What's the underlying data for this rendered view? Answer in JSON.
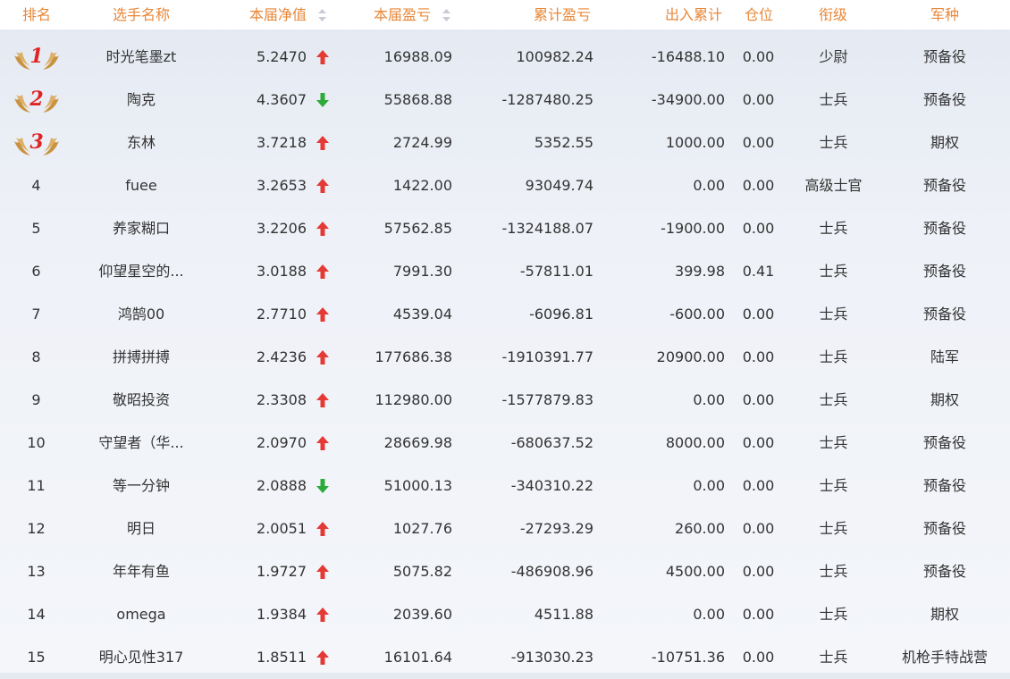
{
  "headers": {
    "rank": "排名",
    "name": "选手名称",
    "nav": "本届净值",
    "pnl": "本届盈亏",
    "total_pnl": "累计盈亏",
    "flow": "出入累计",
    "position": "仓位",
    "title": "衔级",
    "corps": "军种"
  },
  "rows": [
    {
      "rank": "1",
      "name": "时光笔墨zt",
      "nav": "5.2470",
      "trend": "up",
      "pnl": "16988.09",
      "total_pnl": "100982.24",
      "flow": "-16488.10",
      "position": "0.00",
      "title": "少尉",
      "corps": "预备役"
    },
    {
      "rank": "2",
      "name": "陶克",
      "nav": "4.3607",
      "trend": "down",
      "pnl": "55868.88",
      "total_pnl": "-1287480.25",
      "flow": "-34900.00",
      "position": "0.00",
      "title": "士兵",
      "corps": "预备役"
    },
    {
      "rank": "3",
      "name": "东林",
      "nav": "3.7218",
      "trend": "up",
      "pnl": "2724.99",
      "total_pnl": "5352.55",
      "flow": "1000.00",
      "position": "0.00",
      "title": "士兵",
      "corps": "期权"
    },
    {
      "rank": "4",
      "name": "fuee",
      "nav": "3.2653",
      "trend": "up",
      "pnl": "1422.00",
      "total_pnl": "93049.74",
      "flow": "0.00",
      "position": "0.00",
      "title": "高级士官",
      "corps": "预备役"
    },
    {
      "rank": "5",
      "name": "养家糊口",
      "nav": "3.2206",
      "trend": "up",
      "pnl": "57562.85",
      "total_pnl": "-1324188.07",
      "flow": "-1900.00",
      "position": "0.00",
      "title": "士兵",
      "corps": "预备役"
    },
    {
      "rank": "6",
      "name": "仰望星空的...",
      "nav": "3.0188",
      "trend": "up",
      "pnl": "7991.30",
      "total_pnl": "-57811.01",
      "flow": "399.98",
      "position": "0.41",
      "title": "士兵",
      "corps": "预备役"
    },
    {
      "rank": "7",
      "name": "鸿鹄00",
      "nav": "2.7710",
      "trend": "up",
      "pnl": "4539.04",
      "total_pnl": "-6096.81",
      "flow": "-600.00",
      "position": "0.00",
      "title": "士兵",
      "corps": "预备役"
    },
    {
      "rank": "8",
      "name": "拼搏拼搏",
      "nav": "2.4236",
      "trend": "up",
      "pnl": "177686.38",
      "total_pnl": "-1910391.77",
      "flow": "20900.00",
      "position": "0.00",
      "title": "士兵",
      "corps": "陆军"
    },
    {
      "rank": "9",
      "name": "敬昭投资",
      "nav": "2.3308",
      "trend": "up",
      "pnl": "112980.00",
      "total_pnl": "-1577879.83",
      "flow": "0.00",
      "position": "0.00",
      "title": "士兵",
      "corps": "期权"
    },
    {
      "rank": "10",
      "name": "守望者（华...",
      "nav": "2.0970",
      "trend": "up",
      "pnl": "28669.98",
      "total_pnl": "-680637.52",
      "flow": "8000.00",
      "position": "0.00",
      "title": "士兵",
      "corps": "预备役"
    },
    {
      "rank": "11",
      "name": "等一分钟",
      "nav": "2.0888",
      "trend": "down",
      "pnl": "51000.13",
      "total_pnl": "-340310.22",
      "flow": "0.00",
      "position": "0.00",
      "title": "士兵",
      "corps": "预备役"
    },
    {
      "rank": "12",
      "name": "明日",
      "nav": "2.0051",
      "trend": "up",
      "pnl": "1027.76",
      "total_pnl": "-27293.29",
      "flow": "260.00",
      "position": "0.00",
      "title": "士兵",
      "corps": "预备役"
    },
    {
      "rank": "13",
      "name": "年年有鱼",
      "nav": "1.9727",
      "trend": "up",
      "pnl": "5075.82",
      "total_pnl": "-486908.96",
      "flow": "4500.00",
      "position": "0.00",
      "title": "士兵",
      "corps": "预备役"
    },
    {
      "rank": "14",
      "name": "omega",
      "nav": "1.9384",
      "trend": "up",
      "pnl": "2039.60",
      "total_pnl": "4511.88",
      "flow": "0.00",
      "position": "0.00",
      "title": "士兵",
      "corps": "期权"
    },
    {
      "rank": "15",
      "name": "明心见性317",
      "nav": "1.8511",
      "trend": "up",
      "pnl": "16101.64",
      "total_pnl": "-913030.23",
      "flow": "-10751.36",
      "position": "0.00",
      "title": "士兵",
      "corps": "机枪手特战营"
    }
  ],
  "icons": {
    "up": "arrow-up-icon",
    "down": "arrow-down-icon",
    "medal": "laurel-wings-icon",
    "sort": "sort-icon"
  },
  "colors": {
    "header_text": "#e8883a",
    "arrow_up": "#e53935",
    "arrow_down": "#2eaa3a",
    "medal_number": "#e02424",
    "medal_wing": "#c9923e",
    "sort_icon": "#c8ccd4"
  }
}
